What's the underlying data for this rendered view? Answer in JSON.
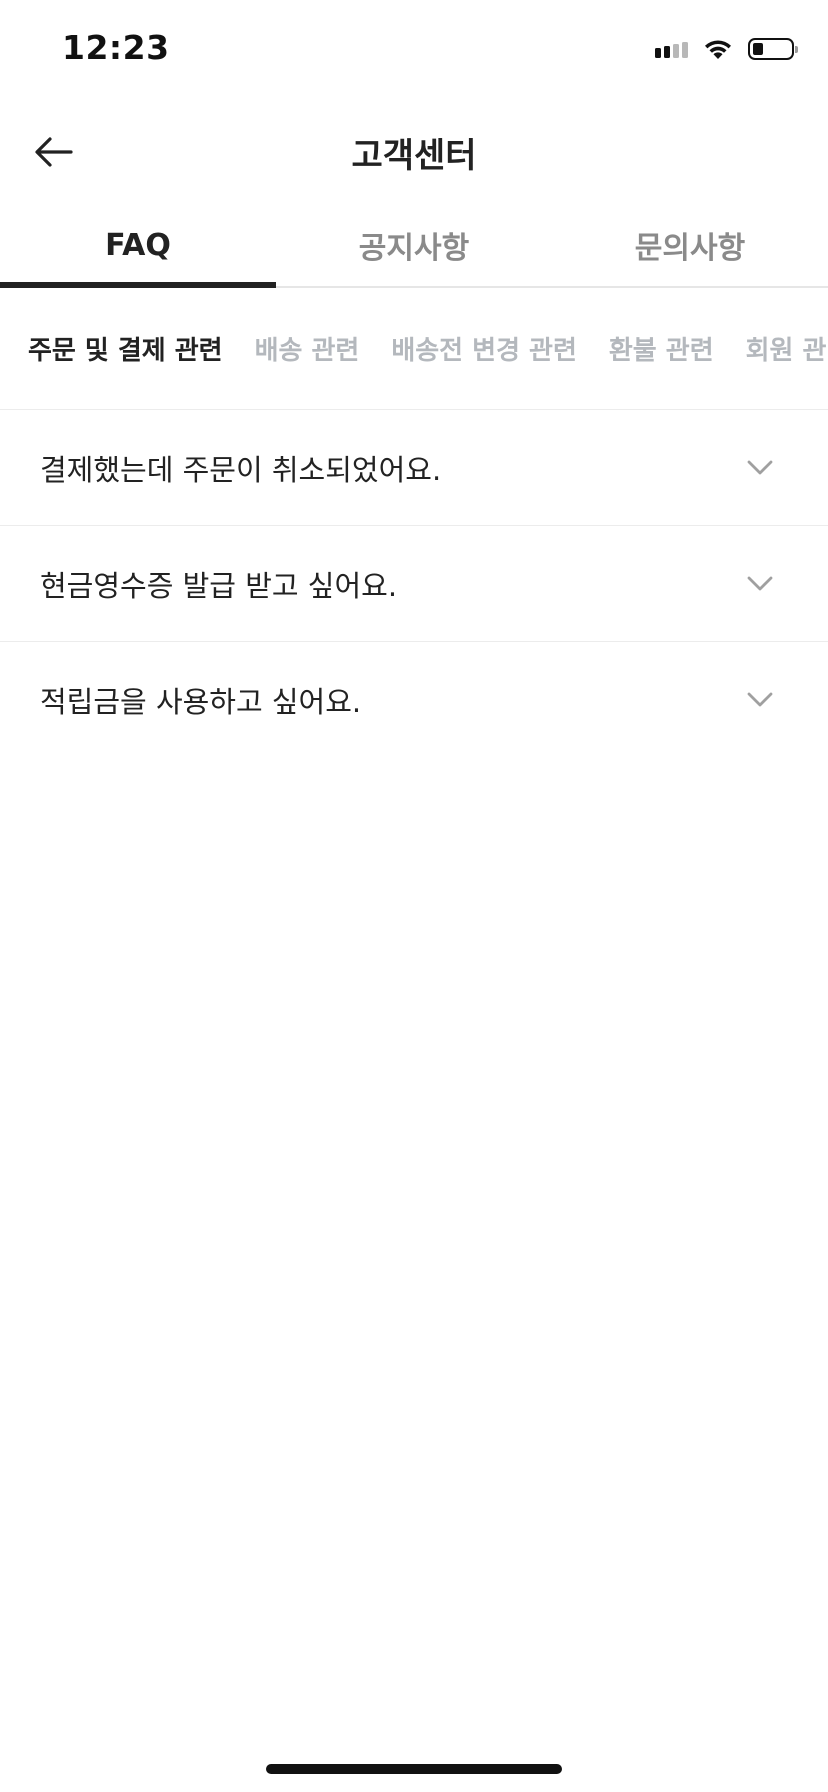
{
  "status_bar": {
    "time": "12:23"
  },
  "header": {
    "title": "고객센터",
    "back_icon": "arrow-left-icon"
  },
  "tabs": [
    {
      "label": "FAQ",
      "active": true
    },
    {
      "label": "공지사항",
      "active": false
    },
    {
      "label": "문의사항",
      "active": false
    }
  ],
  "categories": [
    {
      "label": "주문 및 결제 관련",
      "active": true
    },
    {
      "label": "배송 관련",
      "active": false
    },
    {
      "label": "배송전 변경 관련",
      "active": false
    },
    {
      "label": "환불 관련",
      "active": false
    },
    {
      "label": "회원 관련",
      "active": false
    }
  ],
  "faq": [
    {
      "question": "결제했는데 주문이 취소되었어요.",
      "icon": "chevron-down-icon"
    },
    {
      "question": "현금영수증 발급 받고 싶어요.",
      "icon": "chevron-down-icon"
    },
    {
      "question": "적립금을 사용하고 싶어요.",
      "icon": "chevron-down-icon"
    }
  ],
  "colors": {
    "text_primary": "#222222",
    "text_inactive_tab": "#8a8a8a",
    "text_inactive_category": "#b4b8bd",
    "divider": "#ececec",
    "chevron": "#a0a0a0"
  }
}
